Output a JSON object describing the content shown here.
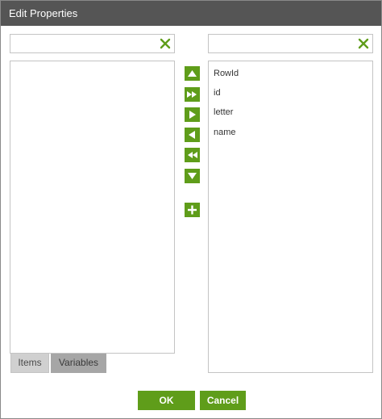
{
  "dialog": {
    "title": "Edit Properties"
  },
  "left_panel": {
    "search": {
      "value": "",
      "placeholder": ""
    },
    "items": [],
    "tabs": [
      {
        "label": "Items",
        "active": true
      },
      {
        "label": "Variables",
        "active": false
      }
    ]
  },
  "right_panel": {
    "search": {
      "value": "",
      "placeholder": ""
    },
    "items": [
      "RowId",
      "id",
      "letter",
      "name"
    ]
  },
  "move_controls": [
    {
      "icon": "move-up-icon",
      "action": "move up"
    },
    {
      "icon": "move-all-right-icon",
      "action": "move all right"
    },
    {
      "icon": "move-right-icon",
      "action": "move right"
    },
    {
      "icon": "move-left-icon",
      "action": "move left"
    },
    {
      "icon": "move-all-left-icon",
      "action": "move all left"
    },
    {
      "icon": "move-down-icon",
      "action": "move down"
    },
    {
      "icon": "add-icon",
      "action": "add"
    }
  ],
  "footer": {
    "ok_label": "OK",
    "cancel_label": "Cancel"
  },
  "colors": {
    "accent": "#5f9d1a",
    "titlebar": "#555555",
    "clear_icon": "#5f9d1a"
  }
}
